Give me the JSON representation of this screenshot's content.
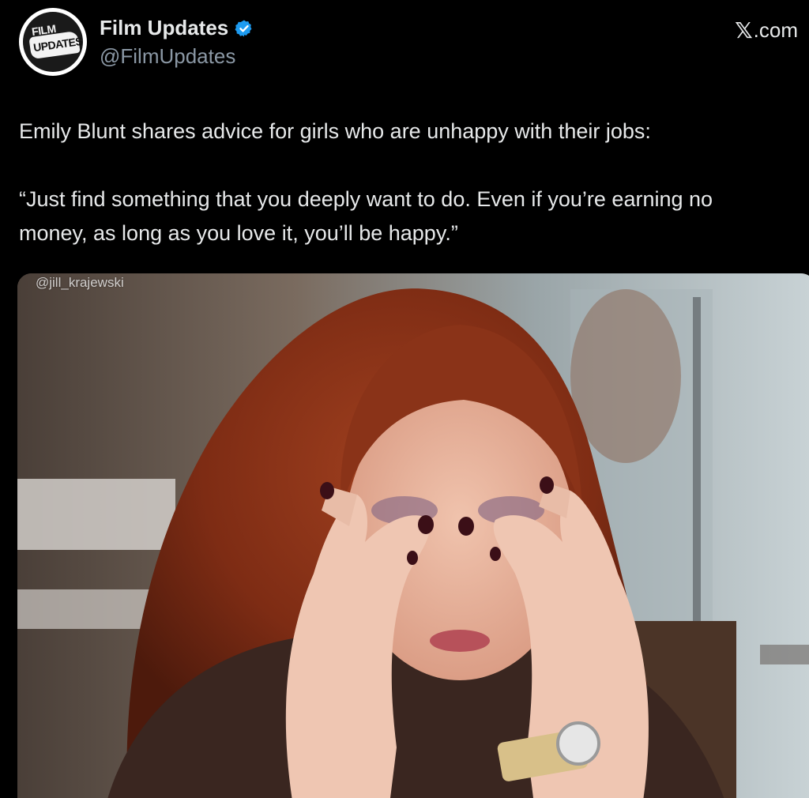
{
  "author": {
    "display_name": "Film Updates",
    "handle": "@FilmUpdates",
    "verified": true,
    "avatar_text_line1": "FILM",
    "avatar_text_line2": "UPDATES"
  },
  "brand": {
    "x_glyph": "𝕏",
    "domain": ".com"
  },
  "tweet": {
    "line1": "Emily Blunt shares advice for girls who are unhappy with their jobs:",
    "quote_line1": "“Just find something that you deeply want to do. Even if you’re earning no",
    "quote_line2": "money, as long as you love it, you’ll be happy.”"
  },
  "media": {
    "watermark": "@jill_krajewski"
  },
  "colors": {
    "background": "#000000",
    "text_primary": "#e7e9ea",
    "text_secondary": "#8b98a5",
    "verified_blue": "#1d9bf0"
  }
}
